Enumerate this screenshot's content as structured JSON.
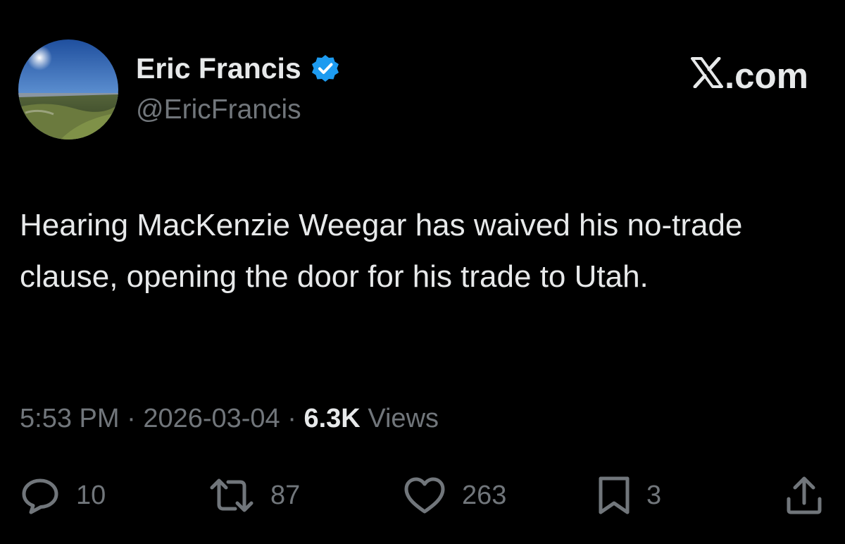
{
  "author": {
    "name": "Eric Francis",
    "handle": "@EricFrancis",
    "verified": true
  },
  "brand": {
    "label": ".com",
    "icon": "x-logo-icon"
  },
  "tweet": {
    "text": "Hearing MacKenzie Weegar has waived his no-trade clause, opening the door for his trade to Utah."
  },
  "meta": {
    "time": "5:53 PM",
    "separator": "·",
    "date": "2026-03-04",
    "views_count": "6.3K",
    "views_label": "Views"
  },
  "actions": {
    "replies": "10",
    "reposts": "87",
    "likes": "263",
    "bookmarks": "3"
  },
  "colors": {
    "background": "#000000",
    "text_primary": "#e7e9ea",
    "text_secondary": "#71767b",
    "verified_badge": "#1d9bf0"
  }
}
